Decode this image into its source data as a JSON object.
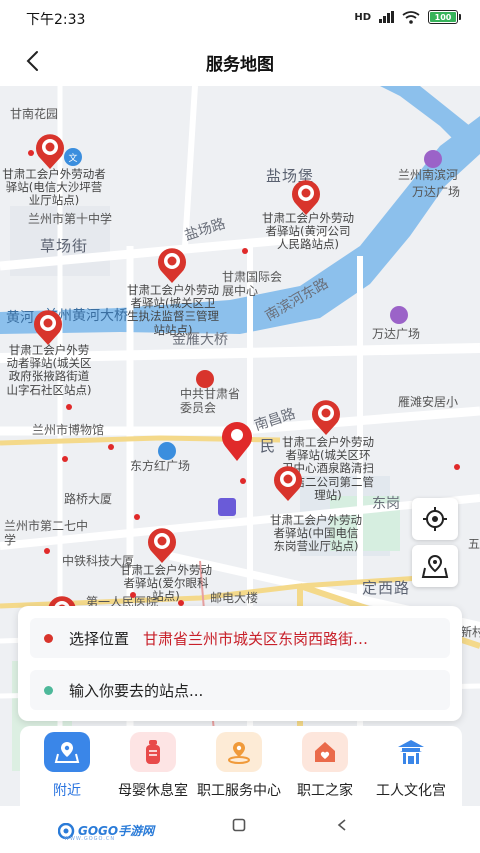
{
  "status_bar": {
    "time": "下午2:33",
    "signal": "HD",
    "battery": "100"
  },
  "header": {
    "title": "服务地图",
    "back_icon": "chevron-left-icon"
  },
  "map": {
    "area_labels": [
      "甘南花园",
      "盐场堡",
      "兰州南滨河",
      "万达广场",
      "草场街",
      "黄河",
      "兰州黄河大桥",
      "盐场路",
      "甘肃国际会展中心",
      "南滨河东路",
      "万达广场",
      "金雁大桥",
      "兰州市第十中学",
      "兰州市博物馆",
      "中共甘肃省委员会",
      "雁滩安居小",
      "路桥大厦",
      "东方红广场",
      "南昌路",
      "民",
      "兰州市第二七中学",
      "中铁科技大厦",
      "邮电大楼",
      "第一人民医院",
      "定西路",
      "东岗",
      "新村",
      "五",
      "文"
    ],
    "station_labels": [
      "甘肃工会户外劳动者驿站(电信大沙坪营业厅站点)",
      "甘肃工会户外劳动者驿站(黄河公司人民路站点)",
      "甘肃工会户外劳动者驿站(城关区卫生执法监督三管理站站点)",
      "甘肃工会户外劳动者驿站(城关区政府张掖路街道山字石社区站点)",
      "甘肃工会户外劳动者驿站(城关区环卫中心酒泉路清扫保洁二公司第二管理站)",
      "甘肃工会户外劳动者驿站(中国电信东岗营业厅站点)",
      "甘肃工会户外劳动者驿站(爱尔眼科站点)"
    ]
  },
  "controls": {
    "locate_icon": "crosshair-icon",
    "route_icon": "map-route-icon"
  },
  "search": {
    "select_label": "选择位置",
    "select_value": "甘肃省兰州市城关区东岗西路街…",
    "input_placeholder": "输入你要去的站点..."
  },
  "nav": {
    "items": [
      {
        "label": "附近",
        "icon": "location-map-icon",
        "active": true
      },
      {
        "label": "母婴休息室",
        "icon": "baby-bottle-icon",
        "active": false
      },
      {
        "label": "职工服务中心",
        "icon": "service-pin-icon",
        "active": false
      },
      {
        "label": "职工之家",
        "icon": "heart-home-icon",
        "active": false
      },
      {
        "label": "工人文化宫",
        "icon": "pavilion-icon",
        "active": false
      }
    ]
  },
  "system_bar": {
    "watermark": "GOGO手游网",
    "watermark_sub": "WWW.GOGO.CN"
  },
  "colors": {
    "accent": "#2a74e0",
    "danger": "#c8202a",
    "river": "#7ab6e8",
    "marker": "#d8342c"
  }
}
